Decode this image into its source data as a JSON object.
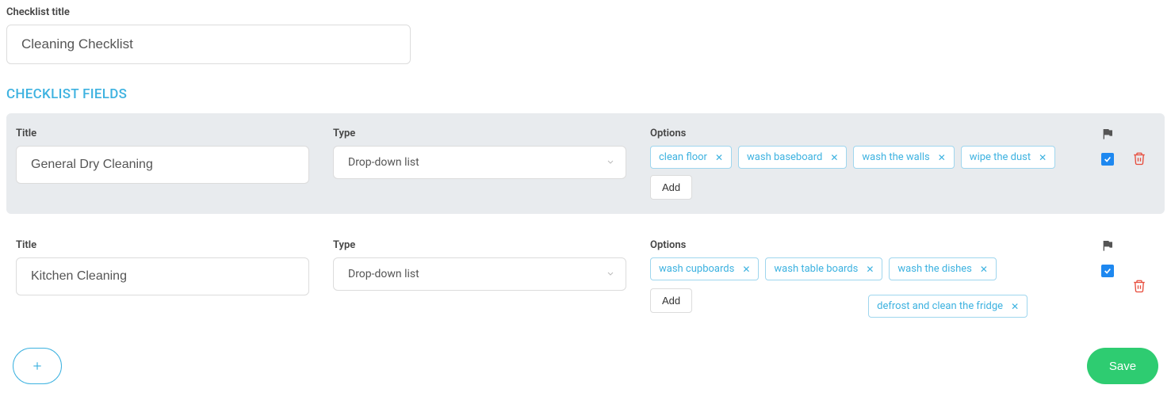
{
  "labels": {
    "checklist_title": "Checklist title",
    "section": "CHECKLIST FIELDS",
    "col_title": "Title",
    "col_type": "Type",
    "col_options": "Options",
    "add": "Add",
    "save": "Save"
  },
  "checklist": {
    "title": "Cleaning Checklist"
  },
  "rows": [
    {
      "title": "General Dry Cleaning",
      "type": "Drop-down list",
      "options": [
        "clean floor",
        "wash baseboard",
        "wash the walls",
        "wipe the dust"
      ],
      "flagged": true,
      "checked": true,
      "active": true
    },
    {
      "title": "Kitchen Cleaning",
      "type": "Drop-down list",
      "options": [
        "wash cupboards",
        "wash table boards",
        "wash the dishes"
      ],
      "extra_option": "defrost and clean the fridge",
      "flagged": true,
      "checked": true,
      "active": false
    }
  ]
}
